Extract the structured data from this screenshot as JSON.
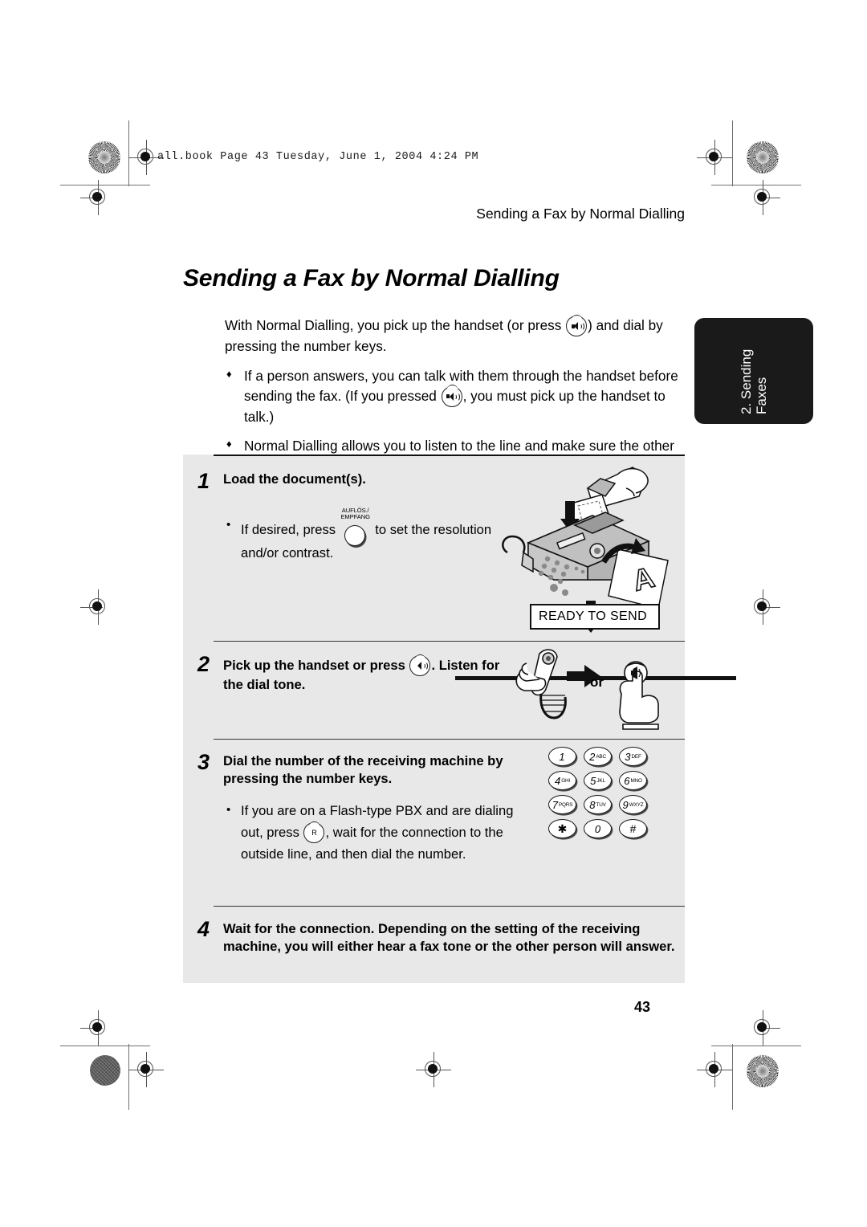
{
  "print_slug": "all.book  Page 43  Tuesday, June 1, 2004  4:24 PM",
  "running_head": "Sending a Fax by Normal Dialling",
  "page_title": "Sending a Fax by Normal Dialling",
  "chapter_tab": {
    "line1": "2. Sending",
    "line2": "Faxes"
  },
  "intro": {
    "paragraph_pre": "With Normal Dialling, you pick up the handset (or press ",
    "paragraph_post": ") and dial by pressing the number keys.",
    "bullets": [
      {
        "marker": "♦",
        "pre": "If a person answers, you can talk with them through the handset before sending the fax. (If you pressed ",
        "post": ", you must pick up the handset to talk.)"
      },
      {
        "marker": "♦",
        "text": "Normal Dialling allows you to listen to the line and make sure the other fax machine is responding."
      }
    ]
  },
  "steps": [
    {
      "number": "1",
      "heading": "Load the document(s).",
      "sub_marker": "•",
      "sub_pre": "If desired, press ",
      "sub_post": " to set the resolution and/or contrast.",
      "button_label_line1": "AUFLÖS./",
      "button_label_line2": "EMPFANG",
      "display_text": "READY TO SEND"
    },
    {
      "number": "2",
      "heading_pre": "Pick up the handset or press ",
      "heading_post": ". Listen for the dial tone.",
      "or_label": "or"
    },
    {
      "number": "3",
      "heading": "Dial the number of the receiving machine by pressing the number keys.",
      "sub_marker": "•",
      "sub_pre": "If you are on a Flash-type PBX and are dialing out, press ",
      "sub_post": ", wait for the connection to the outside line, and then dial the number.",
      "flash_button_label": "R",
      "keypad": [
        [
          {
            "digit": "1",
            "letters": ""
          },
          {
            "digit": "2",
            "letters": "ABC"
          },
          {
            "digit": "3",
            "letters": "DEF"
          }
        ],
        [
          {
            "digit": "4",
            "letters": "GHI"
          },
          {
            "digit": "5",
            "letters": "JKL"
          },
          {
            "digit": "6",
            "letters": "MNO"
          }
        ],
        [
          {
            "digit": "7",
            "letters": "PQRS"
          },
          {
            "digit": "8",
            "letters": "TUV"
          },
          {
            "digit": "9",
            "letters": "WXYZ"
          }
        ],
        [
          {
            "digit": "✱",
            "letters": ""
          },
          {
            "digit": "0",
            "letters": ""
          },
          {
            "digit": "#",
            "letters": ""
          }
        ]
      ]
    },
    {
      "number": "4",
      "heading": "Wait for the connection. Depending on the setting of the receiving machine, you will either hear a fax tone or the other person will answer."
    }
  ],
  "page_number": "43",
  "colors": {
    "panel_background": "#e8e8e8",
    "tab_background": "#1a1a1a",
    "ink": "#000000"
  }
}
